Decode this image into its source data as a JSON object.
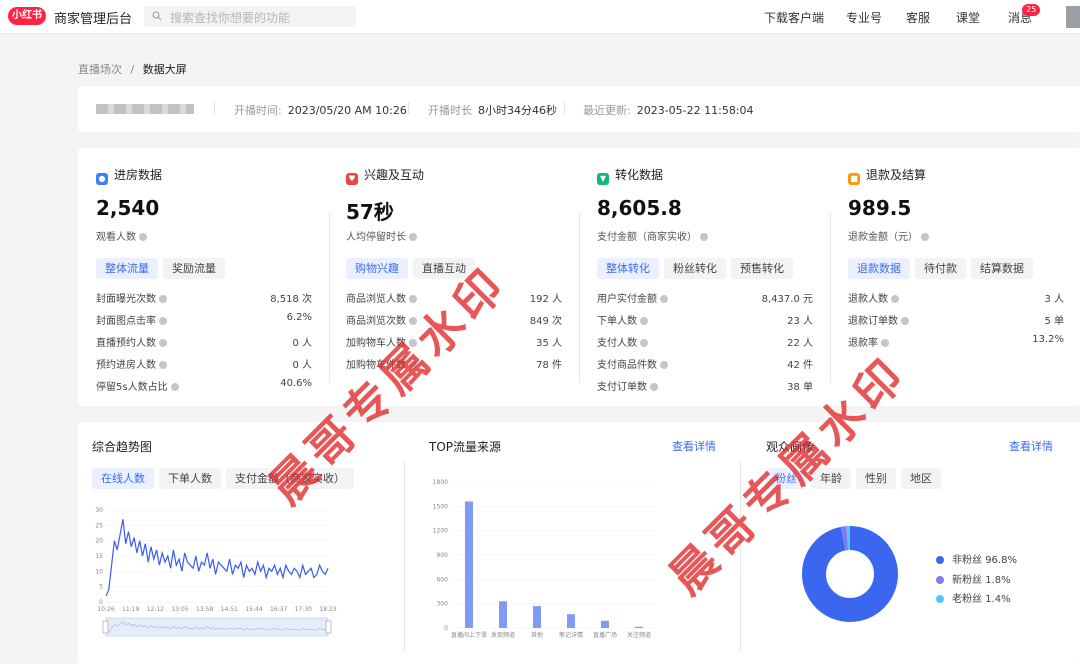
{
  "topbar": {
    "logo": "小红书",
    "app_title": "商家管理后台",
    "search_placeholder": "搜索查找你想要的功能",
    "nav": [
      "下载客户端",
      "专业号",
      "客服",
      "课堂",
      "消息"
    ],
    "message_badge": "25"
  },
  "breadcrumb": {
    "parent": "直播场次",
    "separator": "/",
    "current": "数据大屏"
  },
  "live_info": {
    "start_label": "开播时间:",
    "start_value": "2023/05/20 AM 10:26",
    "duration_label": "开播时长",
    "duration_value": "8小时34分46秒",
    "update_label": "最近更新:",
    "update_value": "2023-05-22 11:58:04"
  },
  "stats": [
    {
      "title": "进房数据",
      "big": "2,540",
      "sub": "观看人数",
      "tabs": [
        "整体流量",
        "奖励流量"
      ],
      "rows": [
        {
          "label": "封面曝光次数",
          "value": "8,518 次"
        },
        {
          "label": "封面图点击率",
          "value": "6.2%"
        },
        {
          "label": "直播预约人数",
          "value": "0 人"
        },
        {
          "label": "预约进房人数",
          "value": "0 人"
        },
        {
          "label": "停留5s人数占比",
          "value": "40.6%"
        }
      ]
    },
    {
      "title": "兴趣及互动",
      "big": "57秒",
      "sub": "人均停留时长",
      "tabs": [
        "购物兴趣",
        "直播互动"
      ],
      "rows": [
        {
          "label": "商品浏览人数",
          "value": "192 人"
        },
        {
          "label": "商品浏览次数",
          "value": "849 次"
        },
        {
          "label": "加购物车人数",
          "value": "35 人"
        },
        {
          "label": "加购物车件数",
          "value": "78 件"
        }
      ]
    },
    {
      "title": "转化数据",
      "big": "8,605.8",
      "sub": "支付金额（商家实收）",
      "tabs": [
        "整体转化",
        "粉丝转化",
        "预售转化"
      ],
      "rows": [
        {
          "label": "用户实付金额",
          "value": "8,437.0 元"
        },
        {
          "label": "下单人数",
          "value": "23 人"
        },
        {
          "label": "支付人数",
          "value": "22 人"
        },
        {
          "label": "支付商品件数",
          "value": "42 件"
        },
        {
          "label": "支付订单数",
          "value": "38 单"
        }
      ]
    },
    {
      "title": "退款及结算",
      "big": "989.5",
      "sub": "退款金额（元）",
      "tabs": [
        "退款数据",
        "待付款",
        "结算数据"
      ],
      "rows": [
        {
          "label": "退款人数",
          "value": "3 人"
        },
        {
          "label": "退款订单数",
          "value": "5 单"
        },
        {
          "label": "退款率",
          "value": "13.2%"
        }
      ]
    }
  ],
  "trend": {
    "title": "综合趋势图",
    "tabs": [
      "在线人数",
      "下单人数",
      "支付金额（商家实收）"
    ]
  },
  "traffic": {
    "title": "TOP流量来源",
    "more": "查看详情"
  },
  "audience": {
    "title": "观众画像",
    "more": "查看详情",
    "tabs": [
      "粉丝",
      "年龄",
      "性别",
      "地区"
    ]
  },
  "watermark": "晨哥专属水印",
  "colors": {
    "accent": "#3c6cf0",
    "brand": "#ff2442",
    "line": "#3a5cf0",
    "bar": "#7f9bf3",
    "donut": [
      "#3a66f0",
      "#7e7cf0",
      "#52c9f0"
    ]
  },
  "chart_data": [
    {
      "type": "line",
      "title": "综合趋势图",
      "x_ticks": [
        "10:26",
        "11:19",
        "12:12",
        "13:05",
        "13:58",
        "14:51",
        "15:44",
        "16:37",
        "17:30",
        "18:23"
      ],
      "y_ticks": [
        0,
        5,
        10,
        15,
        20,
        25,
        30
      ],
      "ylim": [
        0,
        30
      ],
      "series": [
        {
          "values": [
            2,
            4,
            12,
            20,
            17,
            22,
            27,
            19,
            23,
            18,
            21,
            16,
            20,
            15,
            19,
            13,
            18,
            14,
            17,
            12,
            16,
            13,
            15,
            11,
            17,
            12,
            14,
            10,
            16,
            13,
            12,
            11,
            15,
            10,
            13,
            12,
            16,
            11,
            14,
            9,
            13,
            12,
            11,
            10,
            14,
            9,
            12,
            11,
            13,
            8,
            12,
            10,
            11,
            9,
            13,
            10,
            12,
            8,
            11,
            10,
            12,
            9,
            11,
            8,
            12,
            10,
            9,
            11,
            10,
            8,
            12,
            9,
            10,
            11,
            8,
            9,
            12,
            10,
            9,
            11
          ]
        }
      ]
    },
    {
      "type": "bar",
      "title": "TOP流量来源",
      "categories": [
        "直播间上下滑",
        "发现频道",
        "其他",
        "笔记详情",
        "直播广场",
        "关注频道"
      ],
      "values": [
        1560,
        330,
        270,
        170,
        90,
        15
      ],
      "y_ticks": [
        0,
        300,
        600,
        900,
        1200,
        1500,
        1800
      ],
      "ylim": [
        0,
        1800
      ]
    },
    {
      "type": "pie",
      "title": "观众画像",
      "labels": [
        "非粉丝",
        "新粉丝",
        "老粉丝"
      ],
      "values": [
        96.8,
        1.8,
        1.4
      ],
      "value_labels": [
        "96.8%",
        "1.8%",
        "1.4%"
      ]
    }
  ]
}
